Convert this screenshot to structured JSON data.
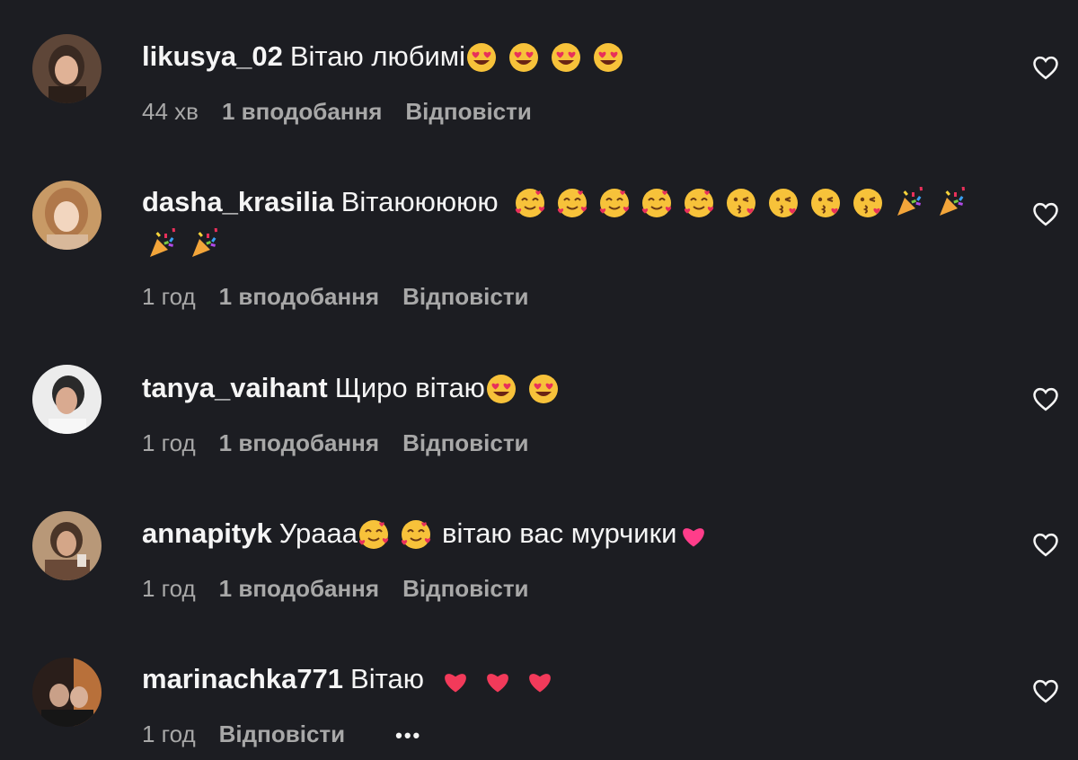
{
  "comments": [
    {
      "username": "likusya_02",
      "text": "Вітаю любимі",
      "emojis": [
        "heart-eyes",
        "heart-eyes",
        "heart-eyes",
        "heart-eyes"
      ],
      "emojis_line2": [],
      "time": "44 хв",
      "likes": "1 вподобання",
      "reply": "Відповісти",
      "avatar_colors": [
        "#7a5a48",
        "#d9a68a",
        "#3b2a22"
      ]
    },
    {
      "username": "dasha_krasilia",
      "text": "Вітаююююю",
      "emojis": [
        "smiling-hearts",
        "smiling-hearts",
        "smiling-hearts",
        "smiling-hearts",
        "smiling-hearts",
        "kissing-heart",
        "kissing-heart",
        "kissing-heart",
        "kissing-heart",
        "party-popper",
        "party-popper"
      ],
      "emojis_line2": [
        "party-popper",
        "party-popper"
      ],
      "time": "1 год",
      "likes": "1 вподобання",
      "reply": "Відповісти",
      "avatar_colors": [
        "#c69a6a",
        "#f0d0b4",
        "#a06a3a"
      ]
    },
    {
      "username": "tanya_vaihant",
      "text": "Щиро вітаю",
      "emojis": [
        "heart-eyes",
        "heart-eyes"
      ],
      "emojis_line2": [],
      "time": "1 год",
      "likes": "1 вподобання",
      "reply": "Відповісти",
      "avatar_colors": [
        "#e8e8e8",
        "#d2a48a",
        "#2a2a2a"
      ]
    },
    {
      "username": "annapityk",
      "text": "Ураaa",
      "text2": "вітаю вас мурчики",
      "emojis": [
        "smiling-hearts",
        "smiling-hearts"
      ],
      "emojis_tail": [
        "pink-heart"
      ],
      "emojis_line2": [],
      "time": "1 год",
      "likes": "1 вподобання",
      "reply": "Відповісти",
      "avatar_colors": [
        "#8a6a4e",
        "#c99a7e",
        "#4a3528"
      ]
    },
    {
      "username": "marinachka771",
      "text": "Вітаю",
      "emojis": [
        "red-heart",
        "red-heart",
        "red-heart"
      ],
      "emojis_line2": [],
      "time": "1 год",
      "likes": "",
      "reply": "Відповісти",
      "more": "•••",
      "avatar_colors": [
        "#3a2a24",
        "#c98a5a",
        "#1a1a1a"
      ]
    }
  ],
  "colors": {
    "background": "#1c1d22",
    "text": "#f5f5f5",
    "muted": "#a8a8a8"
  }
}
